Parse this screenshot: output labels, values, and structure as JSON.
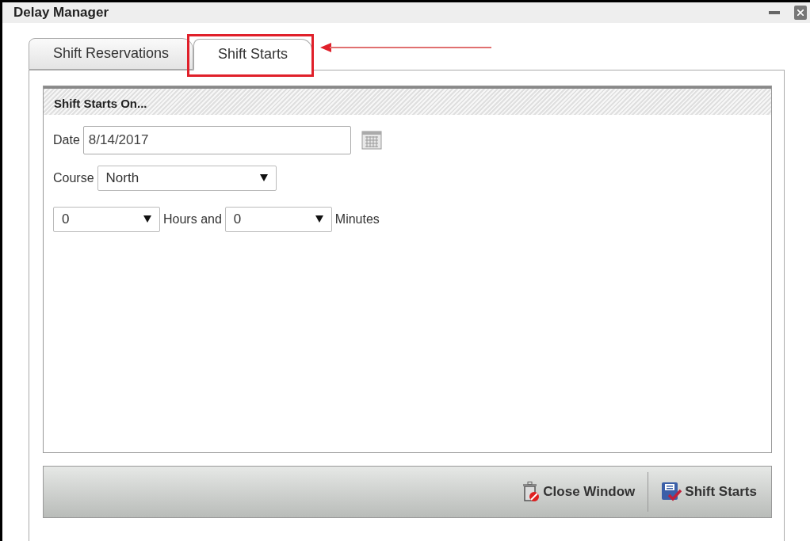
{
  "window": {
    "title": "Delay Manager"
  },
  "tabs": [
    {
      "label": "Shift Reservations",
      "selected": false
    },
    {
      "label": "Shift Starts",
      "selected": true
    }
  ],
  "section": {
    "title": "Shift Starts On..."
  },
  "date": {
    "label": "Date",
    "value": "8/14/2017"
  },
  "course": {
    "label": "Course",
    "value": "North"
  },
  "duration": {
    "hours": "0",
    "hours_label": "Hours and",
    "minutes": "0",
    "minutes_label": "Minutes"
  },
  "buttons": [
    {
      "kind": "close",
      "label": "Close Window"
    },
    {
      "kind": "save",
      "label": "Shift Starts"
    }
  ]
}
